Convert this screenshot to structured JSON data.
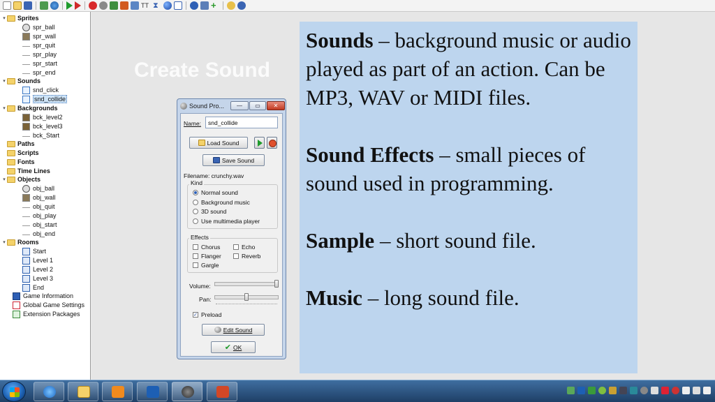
{
  "tree": {
    "sprites": {
      "label": "Sprites",
      "items": [
        "spr_ball",
        "spr_wall",
        "spr_quit",
        "spr_play",
        "spr_start",
        "spr_end"
      ]
    },
    "sounds": {
      "label": "Sounds",
      "items": [
        "snd_click",
        "snd_collide"
      ]
    },
    "backgrounds": {
      "label": "Backgrounds",
      "items": [
        "bck_level2",
        "bck_level3",
        "bck_Start"
      ]
    },
    "paths": "Paths",
    "scripts": "Scripts",
    "fonts": "Fonts",
    "timelines": "Time Lines",
    "objects": {
      "label": "Objects",
      "items": [
        "obj_ball",
        "obj_wall",
        "obj_quit",
        "obj_play",
        "obj_start",
        "obj_end"
      ]
    },
    "rooms": {
      "label": "Rooms",
      "items": [
        "Start",
        "Level 1",
        "Level 2",
        "Level 3",
        "End"
      ]
    },
    "game_info": "Game Information",
    "global_settings": "Global Game Settings",
    "extensions": "Extension Packages"
  },
  "overlay_title": "Create Sound",
  "sound_window": {
    "title": "Sound Pro...",
    "name_label": "Name:",
    "name_value": "snd_collide",
    "load_label": "Load Sound",
    "save_label": "Save Sound",
    "filename": "Filename: crunchy.wav",
    "kind_label": "Kind",
    "kinds": [
      "Normal sound",
      "Background music",
      "3D sound",
      "Use multimedia player"
    ],
    "selected_kind": "Normal sound",
    "effects_label": "Effects",
    "effects": [
      "Chorus",
      "Echo",
      "Flanger",
      "Reverb",
      "Gargle"
    ],
    "volume_label": "Volume:",
    "pan_label": "Pan:",
    "volume_level": 1.0,
    "pan_level": 0.5,
    "preload_label": "Preload",
    "preload_checked": true,
    "edit_label": "Edit Sound",
    "ok_label": "OK"
  },
  "panel": {
    "sounds_term": "Sounds",
    "sounds_def": " – background music or audio played as part of an action.  Can be MP3, WAV or MIDI files.",
    "effects_term": "Sound Effects",
    "effects_def": " – small pieces of sound used in programming.",
    "sample_term": "Sample",
    "sample_def": " – short sound file.",
    "music_term": "Music",
    "music_def": " – long sound file."
  },
  "colors": {
    "panel_bg": "#bdd5ee",
    "taskbar": "#1e3f66",
    "play_green": "#1f9b2c",
    "stop_red": "#e0502d"
  }
}
